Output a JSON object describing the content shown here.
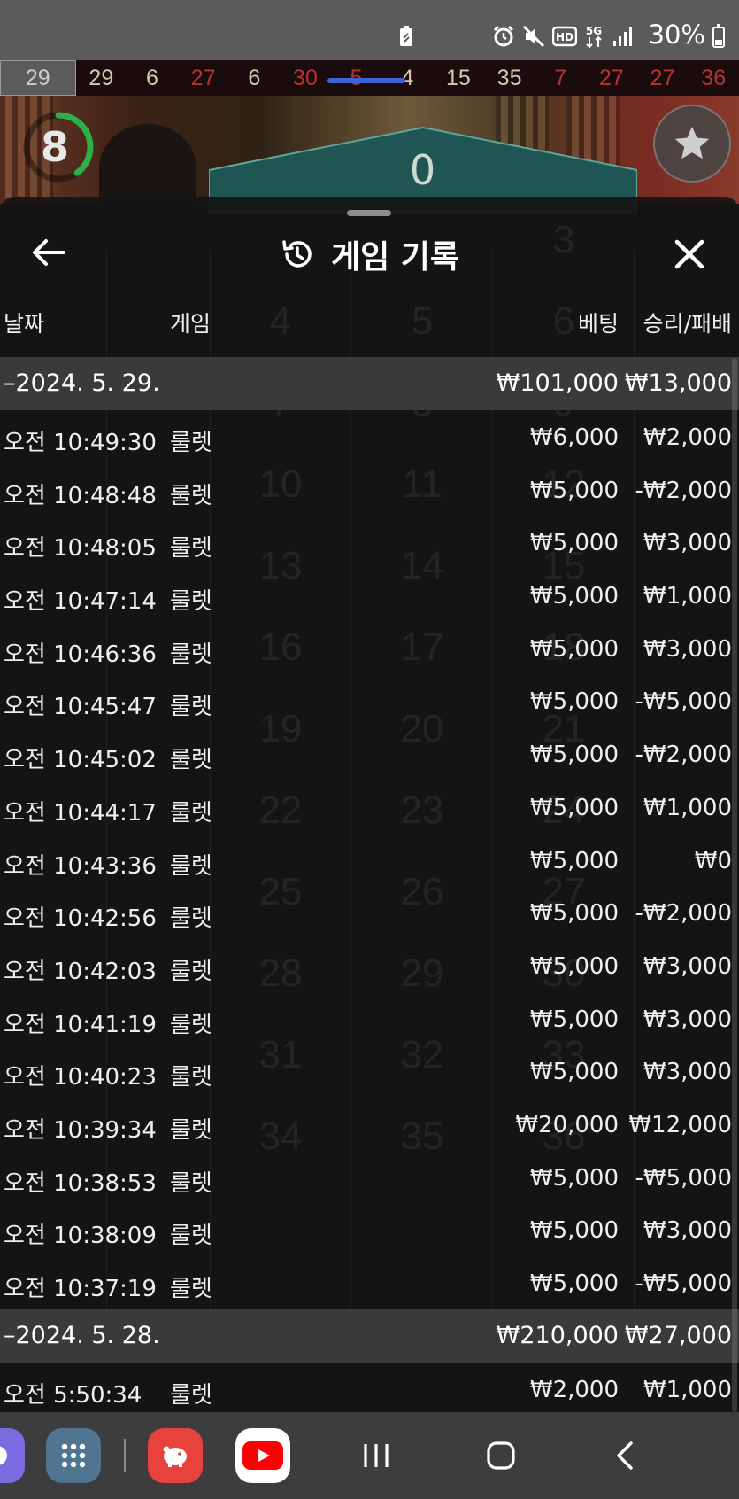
{
  "status_bar": {
    "battery_percent": "30%",
    "icons": [
      "battery-saver-icon",
      "alarm-icon",
      "mute-icon",
      "hd-voice-icon",
      "5g-icon",
      "signal-icon",
      "battery-icon"
    ]
  },
  "results_strip": {
    "numbers": [
      {
        "value": "29",
        "color": "#cccccc",
        "current": true
      },
      {
        "value": "29",
        "color": "#d8c6b0"
      },
      {
        "value": "6",
        "color": "#d8c6b0"
      },
      {
        "value": "27",
        "color": "#b83232"
      },
      {
        "value": "6",
        "color": "#d8c6b0"
      },
      {
        "value": "30",
        "color": "#b83232"
      },
      {
        "value": "5",
        "color": "#b83232"
      },
      {
        "value": "4",
        "color": "#d8c6b0"
      },
      {
        "value": "15",
        "color": "#d8c6b0"
      },
      {
        "value": "35",
        "color": "#d8c6b0"
      },
      {
        "value": "7",
        "color": "#b83232"
      },
      {
        "value": "27",
        "color": "#b83232"
      },
      {
        "value": "27",
        "color": "#b83232"
      },
      {
        "value": "36",
        "color": "#b83232"
      }
    ]
  },
  "game_view": {
    "timer_value": "8",
    "timer_fraction": 0.4,
    "zero_label": "0"
  },
  "history": {
    "title": "게임 기록",
    "columns": {
      "date": "날짜",
      "game": "게임",
      "bet": "베팅",
      "win_loss": "승리/패배"
    },
    "groups": [
      {
        "date": "–2024. 5. 29.",
        "total_bet": "₩101,000",
        "total_win": "₩13,000",
        "rows": [
          {
            "time": "오전 10:49:30",
            "game": "룰렛",
            "bet": "₩6,000",
            "win": "₩2,000"
          },
          {
            "time": "오전 10:48:48",
            "game": "룰렛",
            "bet": "₩5,000",
            "win": "-₩2,000"
          },
          {
            "time": "오전 10:48:05",
            "game": "룰렛",
            "bet": "₩5,000",
            "win": "₩3,000"
          },
          {
            "time": "오전 10:47:14",
            "game": "룰렛",
            "bet": "₩5,000",
            "win": "₩1,000"
          },
          {
            "time": "오전 10:46:36",
            "game": "룰렛",
            "bet": "₩5,000",
            "win": "₩3,000"
          },
          {
            "time": "오전 10:45:47",
            "game": "룰렛",
            "bet": "₩5,000",
            "win": "-₩5,000"
          },
          {
            "time": "오전 10:45:02",
            "game": "룰렛",
            "bet": "₩5,000",
            "win": "-₩2,000"
          },
          {
            "time": "오전 10:44:17",
            "game": "룰렛",
            "bet": "₩5,000",
            "win": "₩1,000"
          },
          {
            "time": "오전 10:43:36",
            "game": "룰렛",
            "bet": "₩5,000",
            "win": "₩0"
          },
          {
            "time": "오전 10:42:56",
            "game": "룰렛",
            "bet": "₩5,000",
            "win": "-₩2,000"
          },
          {
            "time": "오전 10:42:03",
            "game": "룰렛",
            "bet": "₩5,000",
            "win": "₩3,000"
          },
          {
            "time": "오전 10:41:19",
            "game": "룰렛",
            "bet": "₩5,000",
            "win": "₩3,000"
          },
          {
            "time": "오전 10:40:23",
            "game": "룰렛",
            "bet": "₩5,000",
            "win": "₩3,000"
          },
          {
            "time": "오전 10:39:34",
            "game": "룰렛",
            "bet": "₩20,000",
            "win": "₩12,000"
          },
          {
            "time": "오전 10:38:53",
            "game": "룰렛",
            "bet": "₩5,000",
            "win": "-₩5,000"
          },
          {
            "time": "오전 10:38:09",
            "game": "룰렛",
            "bet": "₩5,000",
            "win": "₩3,000"
          },
          {
            "time": "오전 10:37:19",
            "game": "룰렛",
            "bet": "₩5,000",
            "win": "-₩5,000"
          }
        ]
      },
      {
        "date": "–2024. 5. 28.",
        "total_bet": "₩210,000",
        "total_win": "₩27,000",
        "rows": [
          {
            "time": "오전 5:50:34",
            "game": "룰렛",
            "bet": "₩2,000",
            "win": "₩1,000"
          }
        ]
      }
    ]
  },
  "background_table": {
    "numbers": [
      "3",
      "4",
      "5",
      "6",
      "7",
      "8",
      "9",
      "10",
      "11",
      "12",
      "13",
      "14",
      "15",
      "16",
      "17",
      "18",
      "19",
      "20",
      "21",
      "22",
      "23",
      "24",
      "25",
      "26",
      "27",
      "28",
      "29",
      "30",
      "31",
      "32",
      "33",
      "34",
      "35",
      "36"
    ]
  },
  "nav_bar": {
    "apps": [
      "messenger-icon",
      "app-drawer-icon",
      "piggy-bank-app-icon",
      "youtube-icon"
    ],
    "buttons": [
      "recents-button",
      "home-button",
      "back-nav-button"
    ]
  },
  "colors": {
    "panel_bg": "#141414",
    "date_row_bg": "#3a3a3a",
    "strip_red": "#b83232",
    "timer_green": "#2bb04a"
  }
}
